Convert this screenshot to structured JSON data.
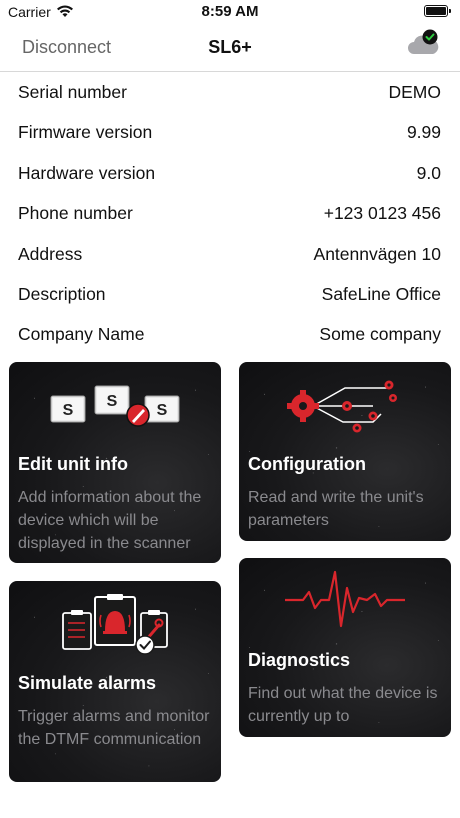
{
  "status_bar": {
    "carrier": "Carrier",
    "time": "8:59 AM"
  },
  "nav": {
    "left_button": "Disconnect",
    "title": "SL6+",
    "cloud_icon": "cloud-synced-icon"
  },
  "info_rows": [
    {
      "label": "Serial number",
      "value": "DEMO"
    },
    {
      "label": "Firmware version",
      "value": "9.99"
    },
    {
      "label": "Hardware version",
      "value": "9.0"
    },
    {
      "label": "Phone number",
      "value": "+123 0123 456"
    },
    {
      "label": "Address",
      "value": "Antennvägen 10"
    },
    {
      "label": "Description",
      "value": "SafeLine Office"
    },
    {
      "label": "Company Name",
      "value": "Some company"
    }
  ],
  "cards": {
    "edit": {
      "title": "Edit unit info",
      "description": "Add information about the device which will be displayed in the scanner",
      "icon": "devices-edit-icon"
    },
    "config": {
      "title": "Configuration",
      "description": "Read and write the unit's parameters",
      "icon": "gears-network-icon"
    },
    "simulate": {
      "title": "Simulate alarms",
      "description": "Trigger alarms and monitor the DTMF communication",
      "icon": "alarm-clipboards-icon"
    },
    "diagnostics": {
      "title": "Diagnostics",
      "description": "Find out what the device is currently up to",
      "icon": "heartbeat-icon"
    }
  },
  "colors": {
    "accent_red": "#d9262c",
    "card_bg": "#18181a",
    "card_desc": "#8a8a8e",
    "cloud_check_green": "#2ecc40"
  }
}
